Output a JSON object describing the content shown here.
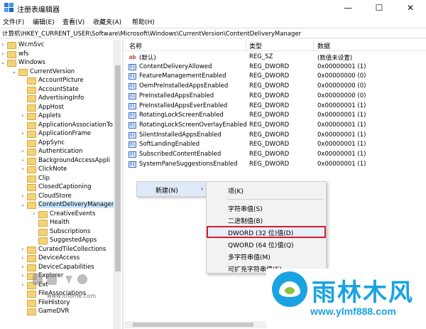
{
  "window": {
    "title": "注册表编辑器",
    "controls": {
      "minimize": "—",
      "maximize": "☐",
      "close": "✕"
    }
  },
  "menu": [
    "文件(F)",
    "编辑(E)",
    "查看(V)",
    "收藏夹(A)",
    "帮助(H)"
  ],
  "address": "计算机\\HKEY_CURRENT_USER\\Software\\Microsoft\\Windows\\CurrentVersion\\ContentDeliveryManager",
  "tree": {
    "items": [
      {
        "label": "WcmSvc",
        "expander": "›"
      },
      {
        "label": "wfs",
        "expander": "›"
      },
      {
        "label": "Windows",
        "expander": "⌄"
      },
      {
        "label": "CurrentVersion",
        "expander": "⌄"
      },
      {
        "label": "AccountPicture",
        "expander": ""
      },
      {
        "label": "AccountState",
        "expander": ""
      },
      {
        "label": "AdvertisingInfo",
        "expander": ""
      },
      {
        "label": "AppHost",
        "expander": ""
      },
      {
        "label": "Applets",
        "expander": "›"
      },
      {
        "label": "ApplicationAssociationTo",
        "expander": ""
      },
      {
        "label": "ApplicationFrame",
        "expander": "›"
      },
      {
        "label": "AppSync",
        "expander": ""
      },
      {
        "label": "Authentication",
        "expander": "›"
      },
      {
        "label": "BackgroundAccessAppli",
        "expander": "›"
      },
      {
        "label": "ClickNote",
        "expander": "›"
      },
      {
        "label": "Clip",
        "expander": ""
      },
      {
        "label": "ClosedCaptioning",
        "expander": ""
      },
      {
        "label": "CloudStore",
        "expander": "›"
      },
      {
        "label": "ContentDeliveryManager",
        "expander": "⌄"
      },
      {
        "label": "CreativeEvents",
        "expander": "›"
      },
      {
        "label": "Health",
        "expander": ""
      },
      {
        "label": "Subscriptions",
        "expander": ""
      },
      {
        "label": "SuggestedApps",
        "expander": ""
      },
      {
        "label": "CuratedTileCollections",
        "expander": "›"
      },
      {
        "label": "DeviceAccess",
        "expander": "›"
      },
      {
        "label": "DeviceCapabilities",
        "expander": "›"
      },
      {
        "label": "Explorer",
        "expander": "›"
      },
      {
        "label": "Ext",
        "expander": "›"
      },
      {
        "label": "FileAssociations",
        "expander": ""
      },
      {
        "label": "FileHistory",
        "expander": ""
      },
      {
        "label": "GameDVR",
        "expander": ""
      }
    ]
  },
  "list": {
    "headers": {
      "name": "名称",
      "type": "类型",
      "data": "数据"
    },
    "rows": [
      {
        "name": "(默认)",
        "type": "REG_SZ",
        "data": "(数值未设置)",
        "icon": "ab"
      },
      {
        "name": "ContentDeliveryAllowed",
        "type": "REG_DWORD",
        "data": "0x00000001 (1)",
        "icon": "dword"
      },
      {
        "name": "FeatureManagementEnabled",
        "type": "REG_DWORD",
        "data": "0x00000000 (0)",
        "icon": "dword"
      },
      {
        "name": "OemPreInstalledAppsEnabled",
        "type": "REG_DWORD",
        "data": "0x00000000 (0)",
        "icon": "dword"
      },
      {
        "name": "PreInstalledAppsEnabled",
        "type": "REG_DWORD",
        "data": "0x00000000 (0)",
        "icon": "dword"
      },
      {
        "name": "PreInstalledAppsEverEnabled",
        "type": "REG_DWORD",
        "data": "0x00000001 (1)",
        "icon": "dword"
      },
      {
        "name": "RotatingLockScreenEnabled",
        "type": "REG_DWORD",
        "data": "0x00000001 (1)",
        "icon": "dword"
      },
      {
        "name": "RotatingLockScreenOverlayEnabled",
        "type": "REG_DWORD",
        "data": "0x00000001 (1)",
        "icon": "dword"
      },
      {
        "name": "SilentInstalledAppsEnabled",
        "type": "REG_DWORD",
        "data": "0x00000001 (1)",
        "icon": "dword"
      },
      {
        "name": "SoftLandingEnabled",
        "type": "REG_DWORD",
        "data": "0x00000001 (1)",
        "icon": "dword"
      },
      {
        "name": "SubscribedContentEnabled",
        "type": "REG_DWORD",
        "data": "0x00000001 (1)",
        "icon": "dword"
      },
      {
        "name": "SystemPaneSuggestionsEnabled",
        "type": "REG_DWORD",
        "data": "0x00000001 (1)",
        "icon": "dword"
      }
    ]
  },
  "context_menu": {
    "new_label": "新建(N)",
    "arrow": "›"
  },
  "submenu": {
    "items": [
      "项(K)",
      "字符串值(S)",
      "二进制值(B)",
      "DWORD (32 位)值(D)",
      "QWORD (64 位)值(Q)",
      "多字符串值(M)",
      "可扩充字符串值(E)"
    ],
    "highlighted_index": 3
  },
  "watermark": {
    "text": "www.ithome.com"
  },
  "logo": {
    "title": "雨林木风",
    "url": "www.ylmf888.com"
  },
  "colors": {
    "selection": "#cce8ff",
    "highlight_border": "#d11f2b",
    "brand": "#1aa3e0"
  }
}
